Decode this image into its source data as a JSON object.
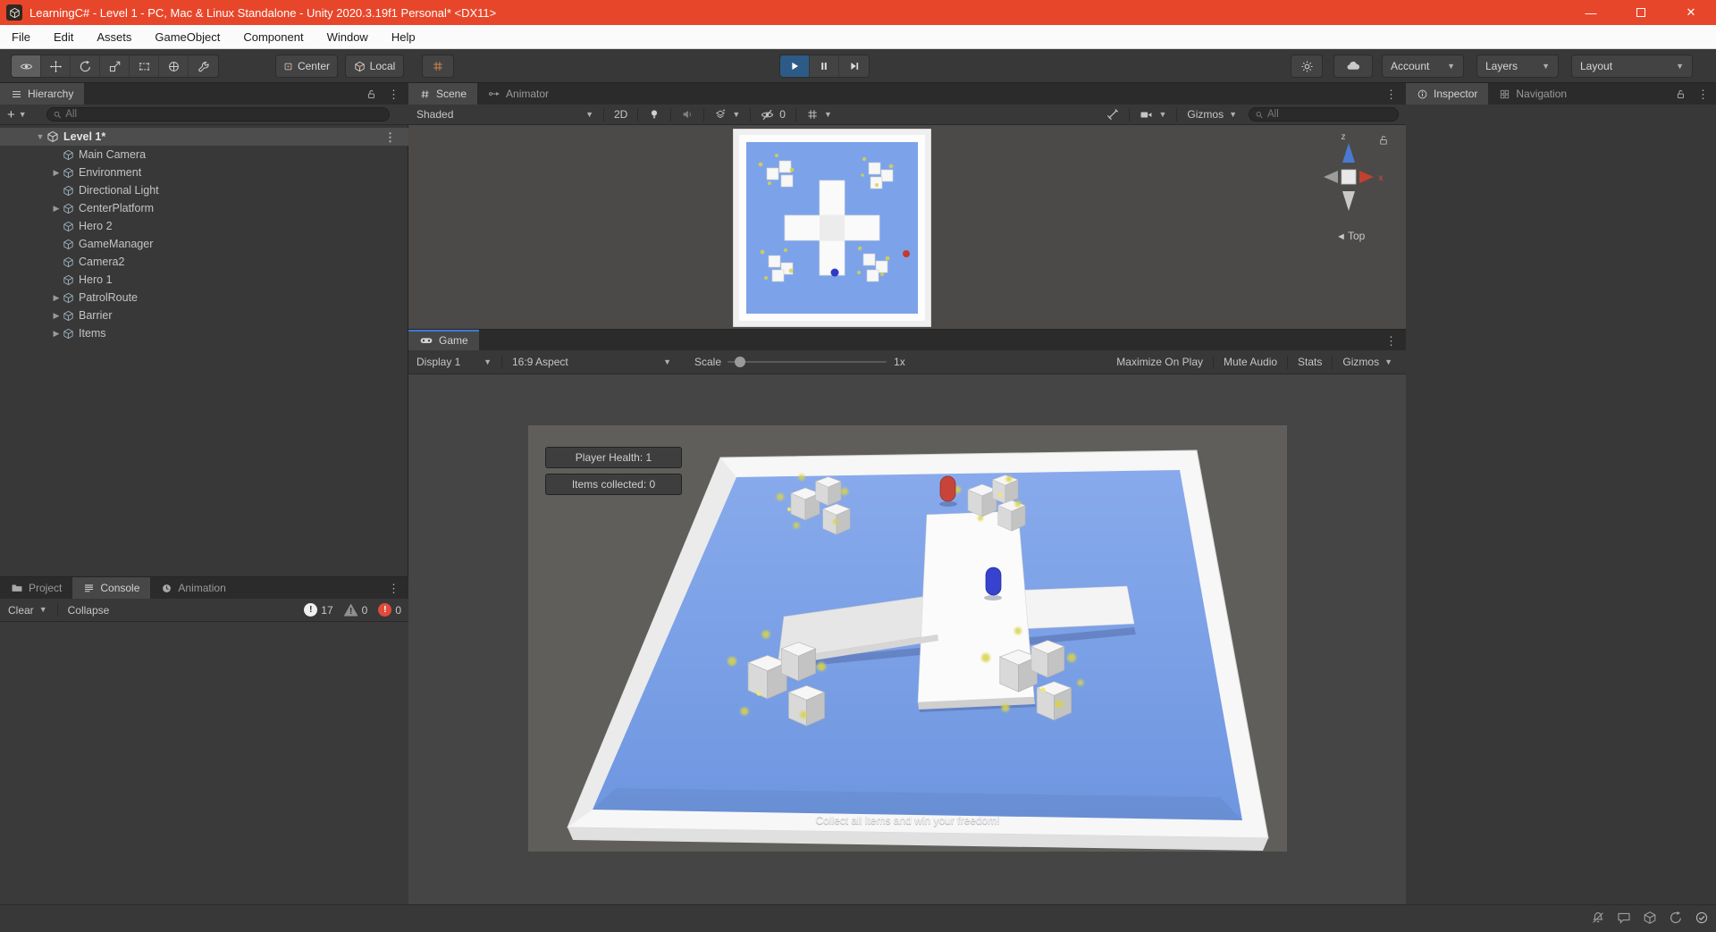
{
  "window": {
    "title": "LearningC# - Level 1 - PC, Mac & Linux Standalone - Unity 2020.3.19f1 Personal* <DX11>"
  },
  "menu": {
    "items": [
      "File",
      "Edit",
      "Assets",
      "GameObject",
      "Component",
      "Window",
      "Help"
    ]
  },
  "toolbar": {
    "center_label": "Center",
    "local_label": "Local",
    "account_label": "Account",
    "layers_label": "Layers",
    "layout_label": "Layout"
  },
  "hierarchy": {
    "tab_label": "Hierarchy",
    "search_placeholder": "All",
    "scene_row": {
      "label": "Level 1*"
    },
    "items": [
      {
        "label": "Main Camera",
        "expandable": false
      },
      {
        "label": "Environment",
        "expandable": true
      },
      {
        "label": "Directional Light",
        "expandable": false
      },
      {
        "label": "CenterPlatform",
        "expandable": true
      },
      {
        "label": "Hero 2",
        "expandable": false
      },
      {
        "label": "GameManager",
        "expandable": false
      },
      {
        "label": "Camera2",
        "expandable": false
      },
      {
        "label": "Hero 1",
        "expandable": false
      },
      {
        "label": "PatrolRoute",
        "expandable": true
      },
      {
        "label": "Barrier",
        "expandable": true
      },
      {
        "label": "Items",
        "expandable": true
      }
    ]
  },
  "scene_view": {
    "tab_scene": "Scene",
    "tab_animator": "Animator",
    "toolbar": {
      "shading_mode": "Shaded",
      "mode_2d": "2D",
      "hidden_count": "0",
      "gizmos_label": "Gizmos",
      "search_placeholder": "All"
    },
    "gizmo": {
      "axis_x": "x",
      "axis_z": "z",
      "view_label": "Top"
    }
  },
  "game_view": {
    "tab_label": "Game",
    "toolbar": {
      "display": "Display 1",
      "aspect": "16:9 Aspect",
      "scale_label": "Scale",
      "scale_value": "1x",
      "maximize_on_play": "Maximize On Play",
      "mute_audio": "Mute Audio",
      "stats": "Stats",
      "gizmos_label": "Gizmos"
    },
    "overlay": {
      "player_health": "Player Health: 1",
      "items_collected": "Items collected: 0",
      "hint": "Collect all items and win your freedom!"
    }
  },
  "console_panel": {
    "tab_project": "Project",
    "tab_console": "Console",
    "tab_animation": "Animation",
    "clear_label": "Clear",
    "collapse_label": "Collapse",
    "log_count": "17",
    "warning_count": "0",
    "error_count": "0"
  },
  "inspector_panel": {
    "tab_inspector": "Inspector",
    "tab_navigation": "Navigation"
  },
  "colors": {
    "titlebar": "#E8462A",
    "play_active": "#2D5B88",
    "tab_focus_line": "#3E78D8",
    "floor_blue": "#7CA3E9",
    "capsule_red": "#C8443A",
    "capsule_blue": "#3743CF",
    "sparkle_yellow": "#D9D34A"
  }
}
